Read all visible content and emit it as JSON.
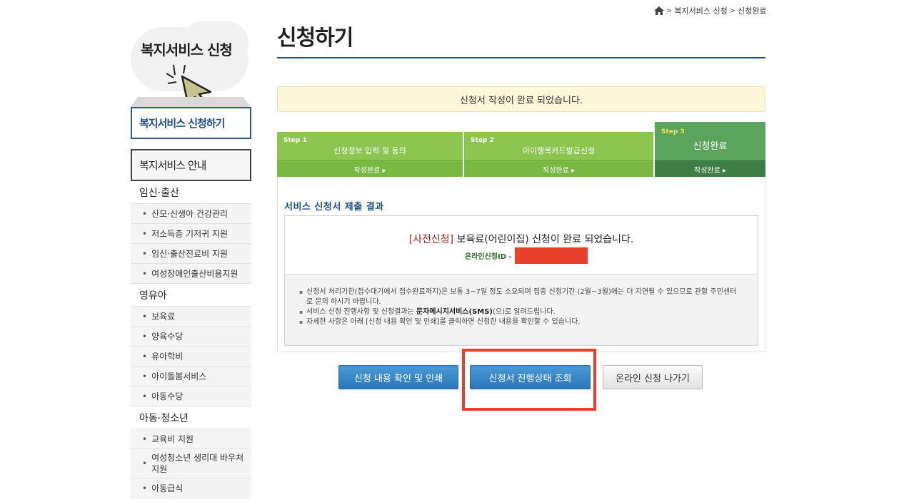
{
  "breadcrumb": {
    "items": [
      "복지서비스 신청",
      "신청완료"
    ]
  },
  "sidebar": {
    "title": "복지서비스 신청",
    "apply_box": "복지서비스 신청하기",
    "guide_box": "복지서비스 안내",
    "categories": [
      {
        "label": "임신·출산",
        "items": [
          "산모·신생아 건강관리",
          "저소득층 기저귀 지원",
          "임신·출산진료비 지원",
          "여성장애인출산비용지원"
        ]
      },
      {
        "label": "영유아",
        "items": [
          "보육료",
          "양육수당",
          "유아학비",
          "아이돌봄서비스",
          "아동수당"
        ]
      },
      {
        "label": "아동·청소년",
        "items": [
          "교육비 지원",
          "여성청소년 생리대 바우처 지원",
          "아동급식"
        ]
      }
    ]
  },
  "main": {
    "page_title": "신청하기",
    "notice": "신청서 작성이 완료 되었습니다.",
    "steps": [
      {
        "num": "Step 1",
        "label": "신청정보 입력 및 동의",
        "status": "작성완료 ▸"
      },
      {
        "num": "Step 2",
        "label": "아이행복카드발급신청",
        "status": "작성완료 ▸"
      },
      {
        "num": "Step 3",
        "label": "신청완료",
        "status": "작성완료 ▸"
      }
    ],
    "result_heading": "서비스 신청서 제출 결과",
    "result": {
      "tag": "[사전신청]",
      "message": " 보육료(어린이집) 신청이 완료 되었습니다.",
      "app_id_label": "온라인신청ID -"
    },
    "notes": [
      "신청서 처리기한(접수대기에서 접수완료까지)은 보통 3~7일 정도 소요되며 집중 신청기간 (2월~3월)에는 더 지연될 수 있으므로 관할 주민센터 로 문의 하시기 바랍니다.",
      {
        "pre": "서비스 신청 진행사항 및 신청결과는 ",
        "bold": "문자메시지서비스(SMS)",
        "post": "(으)로 알려드립니다."
      },
      "자세한 사항은 아래 [신청 내용 확인 및 인쇄]를 클릭하면 신청한 내용을 확인할 수 있습니다."
    ],
    "buttons": {
      "print": "신청 내용 확인 및 인쇄",
      "status": "신청서 진행상태 조회",
      "exit": "온라인 신청 나가기"
    }
  },
  "colors": {
    "accent_blue": "#1f4f86",
    "step_green": "#8cc650",
    "step_active": "#5aa45e",
    "highlight_red": "#e8402a"
  }
}
